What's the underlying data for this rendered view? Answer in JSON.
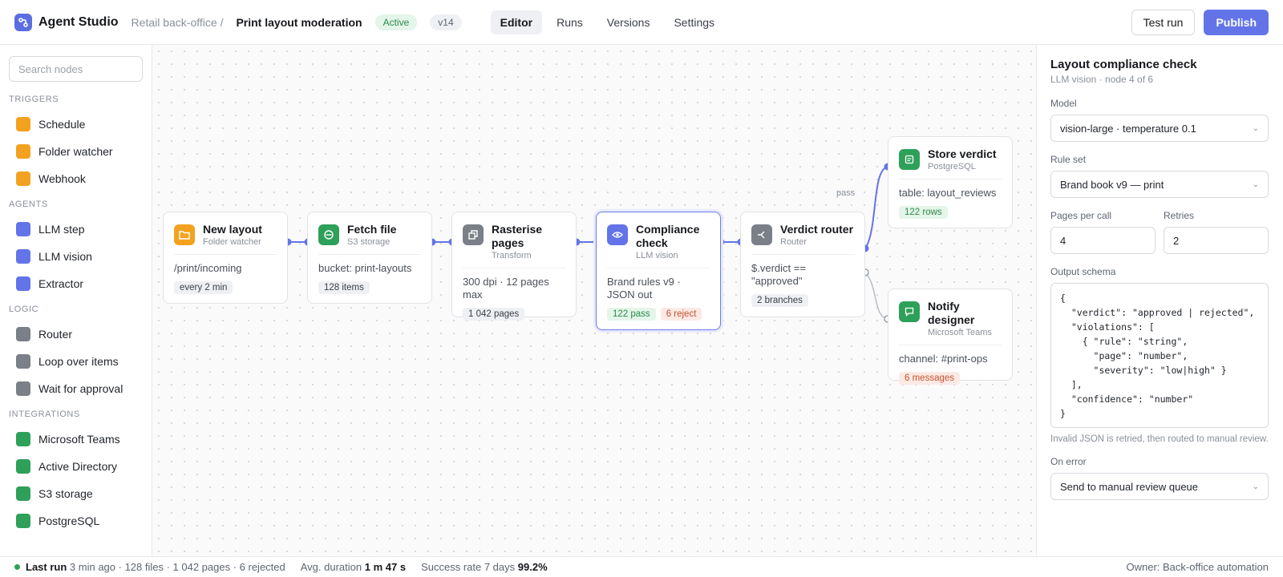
{
  "header": {
    "app_name": "Agent Studio",
    "breadcrumb_parent": "Retail back-office /",
    "title": "Print layout moderation",
    "status": "Active",
    "version": "v14",
    "tabs": [
      {
        "label": "Editor",
        "selected": true
      },
      {
        "label": "Runs",
        "selected": false
      },
      {
        "label": "Versions",
        "selected": false
      },
      {
        "label": "Settings",
        "selected": false
      }
    ],
    "test_run_label": "Test run",
    "publish_label": "Publish"
  },
  "sidebar": {
    "search_placeholder": "Search nodes",
    "sections": [
      {
        "label": "TRIGGERS",
        "color": "#f2a21f",
        "items": [
          "Schedule",
          "Folder watcher",
          "Webhook"
        ]
      },
      {
        "label": "AGENTS",
        "color": "#6374e8",
        "items": [
          "LLM step",
          "LLM vision",
          "Extractor"
        ]
      },
      {
        "label": "LOGIC",
        "color": "#7a7f88",
        "items": [
          "Router",
          "Loop over items",
          "Wait for approval"
        ]
      },
      {
        "label": "INTEGRATIONS",
        "color": "#2fa05a",
        "items": [
          "Microsoft Teams",
          "Active Directory",
          "S3 storage",
          "PostgreSQL"
        ]
      }
    ]
  },
  "canvas": {
    "edge_label_pass": "pass",
    "nodes": {
      "new_layout": {
        "title": "New layout",
        "subtitle": "Folder watcher",
        "detail": "/print/incoming",
        "chip1": "every 2 min",
        "icon": "folder-icon",
        "color": "#f2a21f"
      },
      "fetch_file": {
        "title": "Fetch file",
        "subtitle": "S3 storage",
        "detail": "bucket: print-layouts",
        "chip1": "128 items",
        "icon": "storage-icon",
        "color": "#2fa05a"
      },
      "rasterise": {
        "title": "Rasterise pages",
        "subtitle": "Transform",
        "detail": "300 dpi · 12 pages max",
        "chip1": "1 042 pages",
        "icon": "transform-icon",
        "color": "#7a7f88"
      },
      "compliance": {
        "title": "Compliance check",
        "subtitle": "LLM vision",
        "detail": "Brand rules v9 · JSON out",
        "chip1": "122 pass",
        "chip2": "6 reject",
        "icon": "eye-icon",
        "color": "#6374e8"
      },
      "verdict_router": {
        "title": "Verdict router",
        "subtitle": "Router",
        "detail": "$.verdict == \"approved\"",
        "chip1": "2 branches",
        "icon": "router-icon",
        "color": "#7a7f88"
      },
      "store_verdict": {
        "title": "Store verdict",
        "subtitle": "PostgreSQL",
        "detail": "table: layout_reviews",
        "chip1": "122 rows",
        "icon": "database-icon",
        "color": "#2fa05a"
      },
      "notify_designer": {
        "title": "Notify designer",
        "subtitle": "Microsoft Teams",
        "detail": "channel: #print-ops",
        "chip1": "6 messages",
        "icon": "chat-icon",
        "color": "#2fa05a"
      }
    }
  },
  "panel": {
    "title": "Layout compliance check",
    "subtitle": "LLM vision · node 4 of 6",
    "model_label": "Model",
    "model_value": "vision-large · temperature 0.1",
    "ruleset_label": "Rule set",
    "ruleset_value": "Brand book v9 — print",
    "pages_label": "Pages per call",
    "pages_value": "4",
    "retries_label": "Retries",
    "retries_value": "2",
    "schema_label": "Output schema",
    "schema_value": "{\n  \"verdict\": \"approved | rejected\",\n  \"violations\": [\n    { \"rule\": \"string\",\n      \"page\": \"number\",\n      \"severity\": \"low|high\" }\n  ],\n  \"confidence\": \"number\"\n}",
    "schema_hint": "Invalid JSON is retried, then routed to manual review.",
    "on_error_label": "On error",
    "on_error_value": "Send to manual review queue"
  },
  "footer": {
    "last_run_label": "Last run",
    "last_run_value": "3 min ago · 128 files · 1 042 pages · 6 rejected",
    "avg_label": "Avg. duration",
    "avg_value": "1 m 47 s",
    "success_label": "Success rate 7 days",
    "success_value": "99.2%",
    "owner": "Owner: Back-office automation"
  }
}
